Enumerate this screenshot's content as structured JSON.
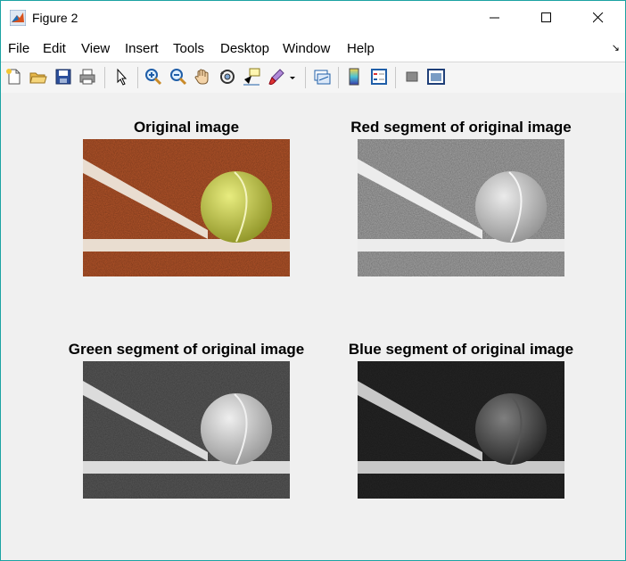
{
  "window": {
    "title": "Figure 2"
  },
  "menu": [
    "File",
    "Edit",
    "View",
    "Insert",
    "Tools",
    "Desktop",
    "Window",
    "Help"
  ],
  "toolbar": {
    "icons": [
      "new-figure-icon",
      "open-file-icon",
      "save-icon",
      "print-icon",
      "select-pointer-icon",
      "zoom-in-icon",
      "zoom-out-icon",
      "pan-hand-icon",
      "rotate-3d-icon",
      "data-cursor-icon",
      "brush-icon",
      "brush-dropdown-icon",
      "link-plot-icon",
      "colorbar-icon",
      "legend-icon",
      "hide-plot-tools-icon",
      "show-plot-tools-icon"
    ]
  },
  "plots": [
    {
      "title": "Original image",
      "channel": "rgb"
    },
    {
      "title": "Red segment of original image",
      "channel": "red"
    },
    {
      "title": "Green segment of original image",
      "channel": "green"
    },
    {
      "title": "Blue segment of original image",
      "channel": "blue"
    }
  ]
}
